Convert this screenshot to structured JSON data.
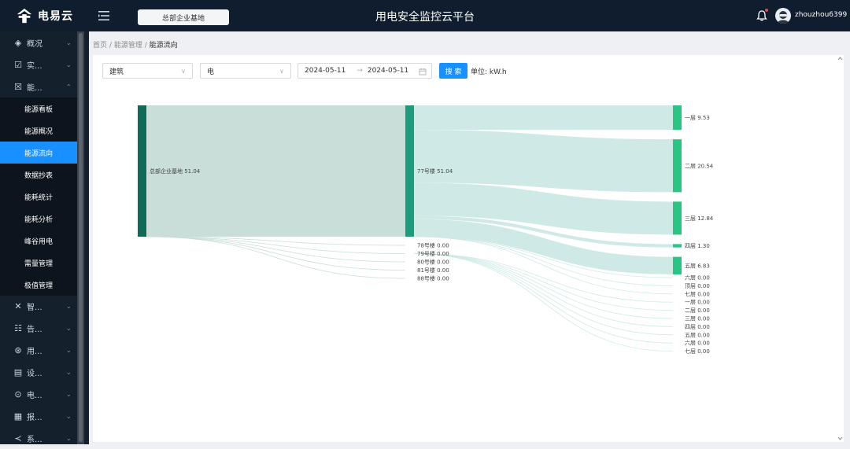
{
  "header": {
    "logo_text": "电易云",
    "org_selector": "总部企业基地",
    "platform_title": "用电安全监控云平台",
    "username": "zhouzhou6399"
  },
  "sidebar": {
    "items": [
      {
        "icon": "overview-icon",
        "label": "概况"
      },
      {
        "icon": "realtime-icon",
        "label": "实..."
      },
      {
        "icon": "energy-icon",
        "label": "能...",
        "expanded": true
      },
      {
        "icon": "smart-icon",
        "label": "智..."
      },
      {
        "icon": "alarm-icon",
        "label": "告..."
      },
      {
        "icon": "electric-icon",
        "label": "用..."
      },
      {
        "icon": "device-icon",
        "label": "设..."
      },
      {
        "icon": "power-icon",
        "label": "电..."
      },
      {
        "icon": "report-icon",
        "label": "报..."
      },
      {
        "icon": "system-icon",
        "label": "系..."
      }
    ],
    "energy_submenu": [
      "能源看板",
      "能源概况",
      "能源流向",
      "数据抄表",
      "能耗统计",
      "能耗分析",
      "峰谷用电",
      "需量管理",
      "极值管理"
    ],
    "active_submenu": "能源流向"
  },
  "breadcrumb": {
    "home": "首页",
    "sep": "/",
    "section": "能源管理",
    "current": "能源流向"
  },
  "filters": {
    "dimension": "建筑",
    "energy_type": "电",
    "date_start": "2024-05-11",
    "date_sep": "→",
    "date_end": "2024-05-11",
    "search_button": "搜 索",
    "unit_label": "单位: kW.h"
  },
  "chart_data": {
    "type": "sankey",
    "unit": "kW.h",
    "nodes": {
      "level1": [
        {
          "name": "总部企业基地",
          "value": 51.04
        }
      ],
      "level2": [
        {
          "name": "77号楼",
          "value": 51.04
        },
        {
          "name": "78号楼",
          "value": 0.0
        },
        {
          "name": "79号楼",
          "value": 0.0
        },
        {
          "name": "80号楼",
          "value": 0.0
        },
        {
          "name": "81号楼",
          "value": 0.0
        },
        {
          "name": "88号楼",
          "value": 0.0
        }
      ],
      "level3": [
        {
          "name": "一层",
          "value": 9.53,
          "parent": "77号楼"
        },
        {
          "name": "二层",
          "value": 20.54,
          "parent": "77号楼"
        },
        {
          "name": "三层",
          "value": 12.84,
          "parent": "77号楼"
        },
        {
          "name": "四层",
          "value": 1.3,
          "parent": "77号楼"
        },
        {
          "name": "五层",
          "value": 6.83,
          "parent": "77号楼"
        },
        {
          "name": "六层",
          "value": 0.0,
          "parent": "77号楼"
        },
        {
          "name": "顶层",
          "value": 0.0,
          "parent": "77号楼"
        },
        {
          "name": "七层",
          "value": 0.0,
          "parent": "77号楼"
        },
        {
          "name": "一层",
          "value": 0.0,
          "parent": "79号楼"
        },
        {
          "name": "二层",
          "value": 0.0,
          "parent": "79号楼"
        },
        {
          "name": "三层",
          "value": 0.0,
          "parent": "79号楼"
        },
        {
          "name": "四层",
          "value": 0.0,
          "parent": "79号楼"
        },
        {
          "name": "五层",
          "value": 0.0,
          "parent": "79号楼"
        },
        {
          "name": "六层",
          "value": 0.0,
          "parent": "79号楼"
        },
        {
          "name": "七层",
          "value": 0.0,
          "parent": "79号楼"
        }
      ]
    },
    "colors": {
      "root": "#0f6b57",
      "building": "#1c9c7d",
      "floor": "#29c582",
      "link_root": "#c9ddd9",
      "link_building": "#cfeae6"
    }
  }
}
